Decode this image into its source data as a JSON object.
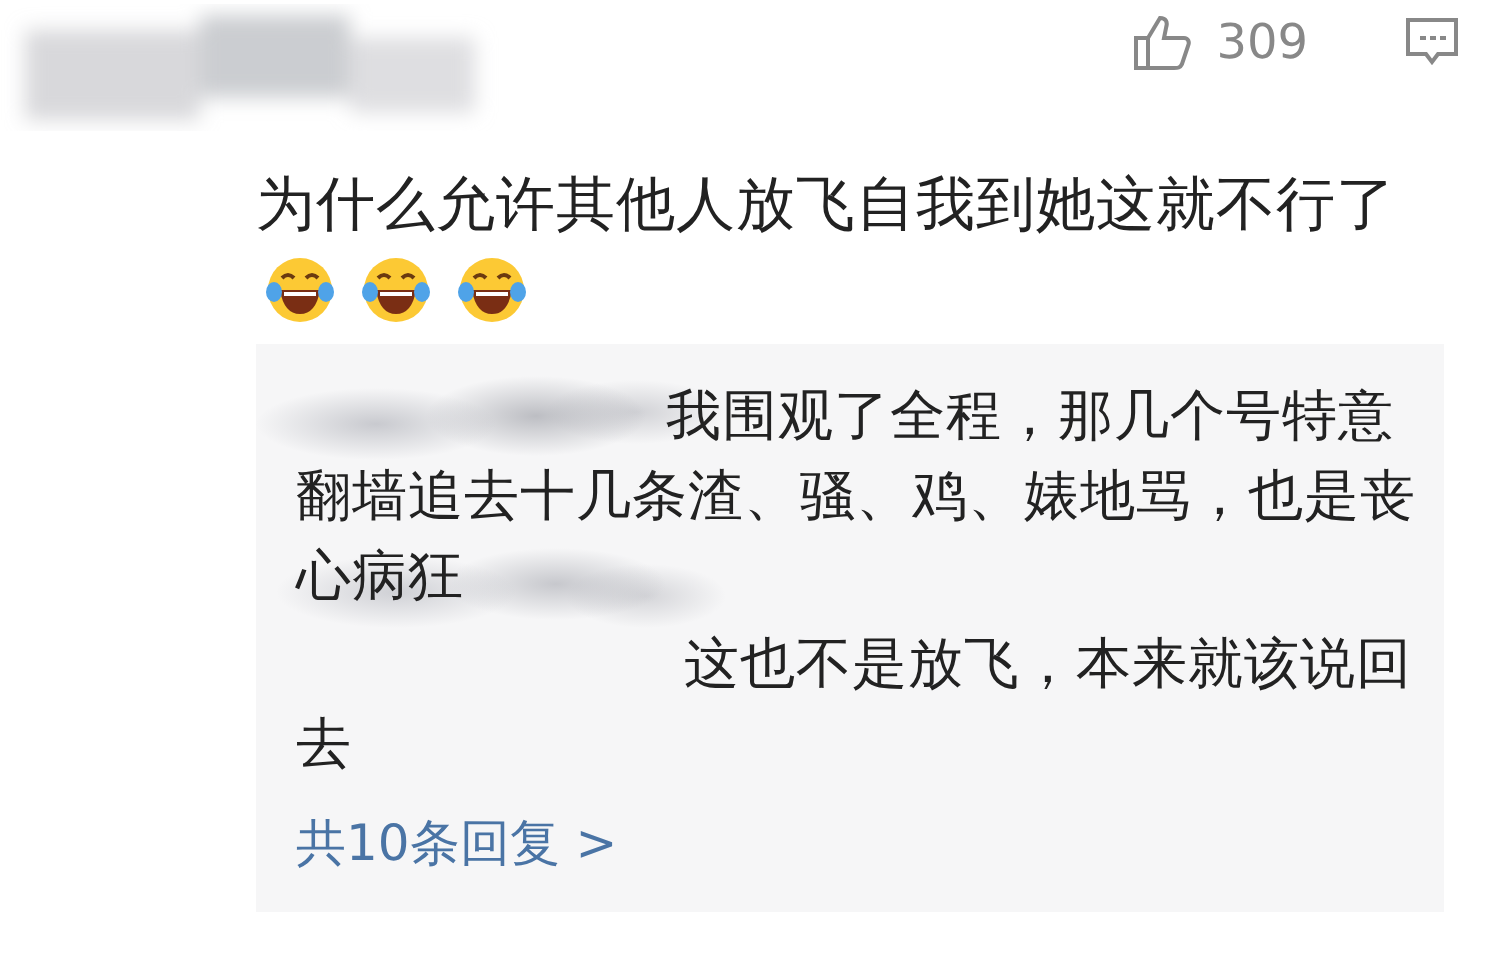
{
  "comment": {
    "likes": "309",
    "text": "为什么允许其他人放飞自我到她这就不行了",
    "emojis": [
      {
        "kind": "laugh-cry"
      },
      {
        "kind": "laugh-cry"
      },
      {
        "kind": "laugh-cry"
      }
    ]
  },
  "replies": [
    {
      "text": "我围观了全程，那几个号特意翻墙追去十几条渣、骚、鸡、婊地骂，也是丧心病狂"
    },
    {
      "text": "这也不是放飞，本来就该说回去"
    }
  ],
  "more_replies": "共10条回复 >"
}
